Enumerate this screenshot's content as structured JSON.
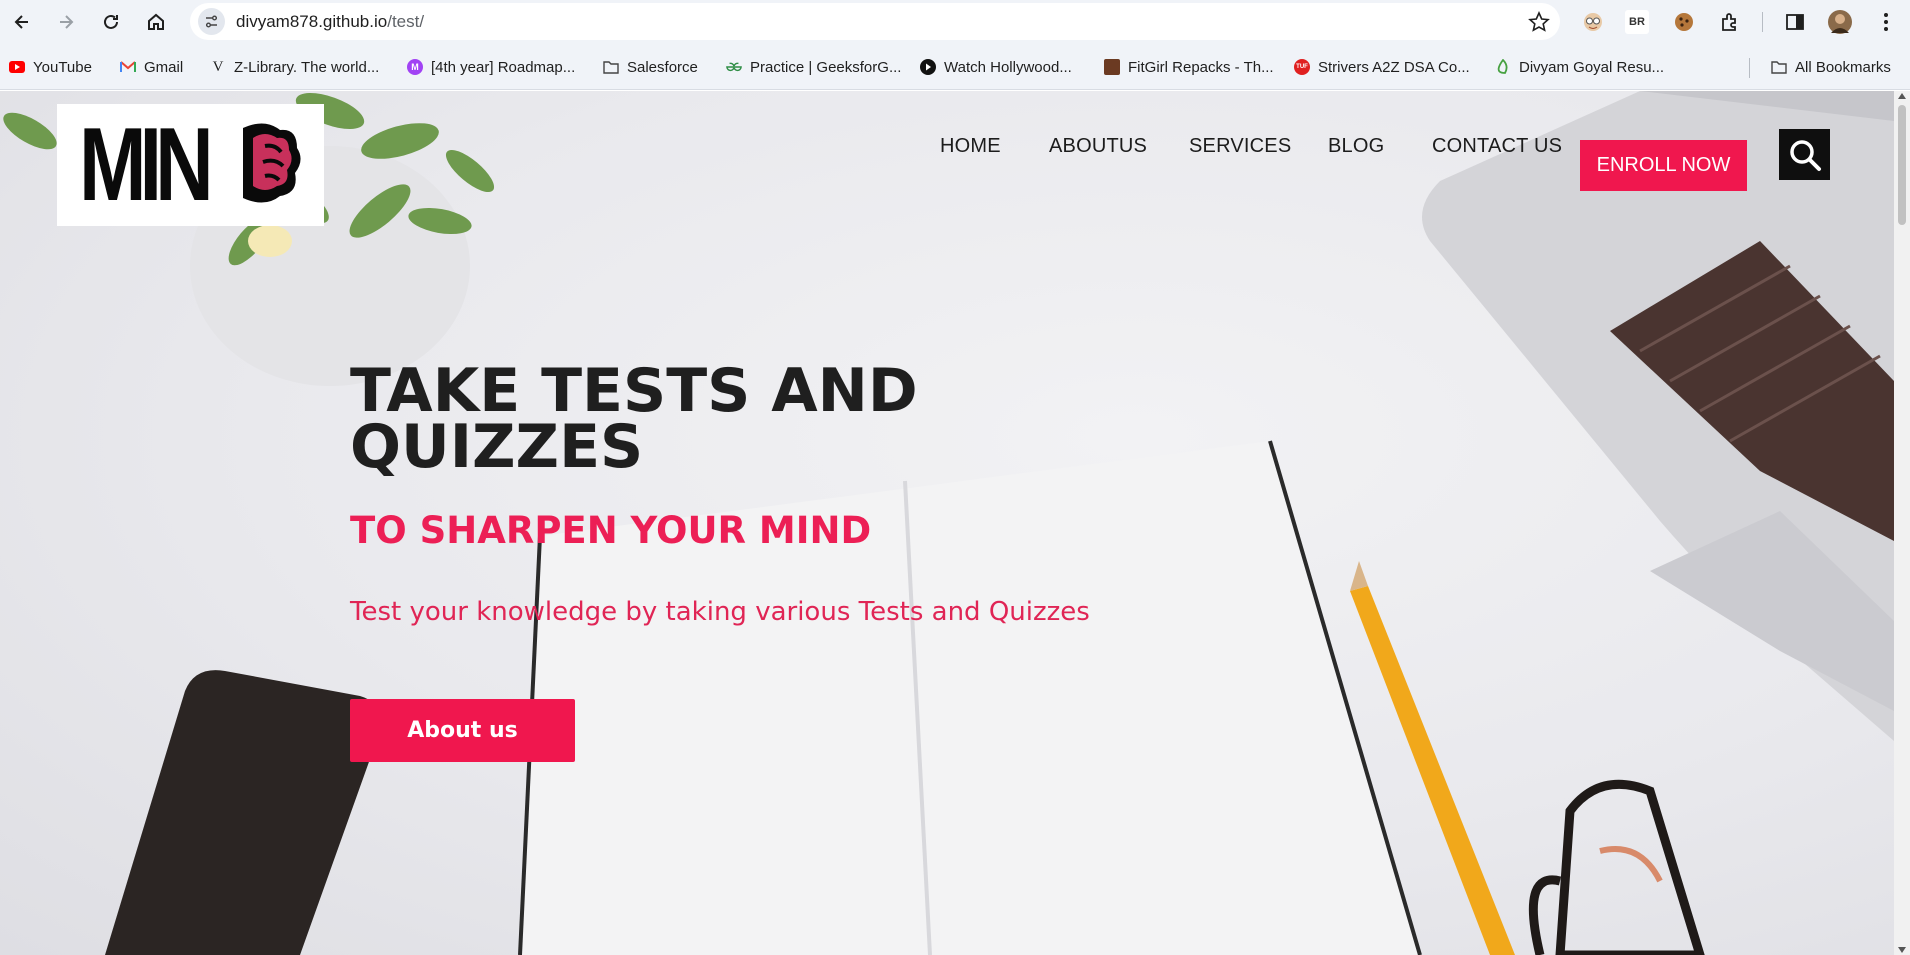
{
  "browser": {
    "url_host": "divyam878.github.io",
    "url_path": "/test/",
    "icons": [
      "back-icon",
      "forward-icon",
      "reload-icon",
      "home-icon",
      "site-info-icon",
      "star-icon",
      "extensions-icon",
      "side-panel-icon",
      "menu-icon"
    ],
    "bookmarks": [
      {
        "label": "YouTube",
        "icon": "youtube-icon"
      },
      {
        "label": "Gmail",
        "icon": "gmail-icon"
      },
      {
        "label": "Z-Library. The world...",
        "icon": "zlibrary-icon"
      },
      {
        "label": "[4th year] Roadmap...",
        "icon": "roadmap-icon"
      },
      {
        "label": "Salesforce",
        "icon": "folder-icon"
      },
      {
        "label": "Practice | GeeksforG...",
        "icon": "geeksforgeeks-icon"
      },
      {
        "label": "Watch Hollywood...",
        "icon": "play-icon"
      },
      {
        "label": "FitGirl Repacks - Th...",
        "icon": "fitgirl-icon"
      },
      {
        "label": "Strivers A2Z DSA Co...",
        "icon": "tuf-icon"
      },
      {
        "label": "Divyam Goyal Resu...",
        "icon": "overleaf-icon"
      }
    ],
    "all_bookmarks": "All Bookmarks",
    "extension_badge": "BR"
  },
  "site": {
    "logo_text": "MIN",
    "nav": [
      "HOME",
      "ABOUTUS",
      "SERVICES",
      "BLOG",
      "CONTACT US"
    ],
    "enroll_label": "ENROLL NOW",
    "hero": {
      "title": "TAKE TESTS AND QUIZZES",
      "subtitle": "TO SHARPEN YOUR MIND",
      "description": "Test your knowledge by taking various Tests and Quizzes",
      "button_label": "About us"
    }
  },
  "colors": {
    "accent": "#f0174e",
    "heading": "#1f1f1f",
    "chrome": "#f0f3f8"
  }
}
